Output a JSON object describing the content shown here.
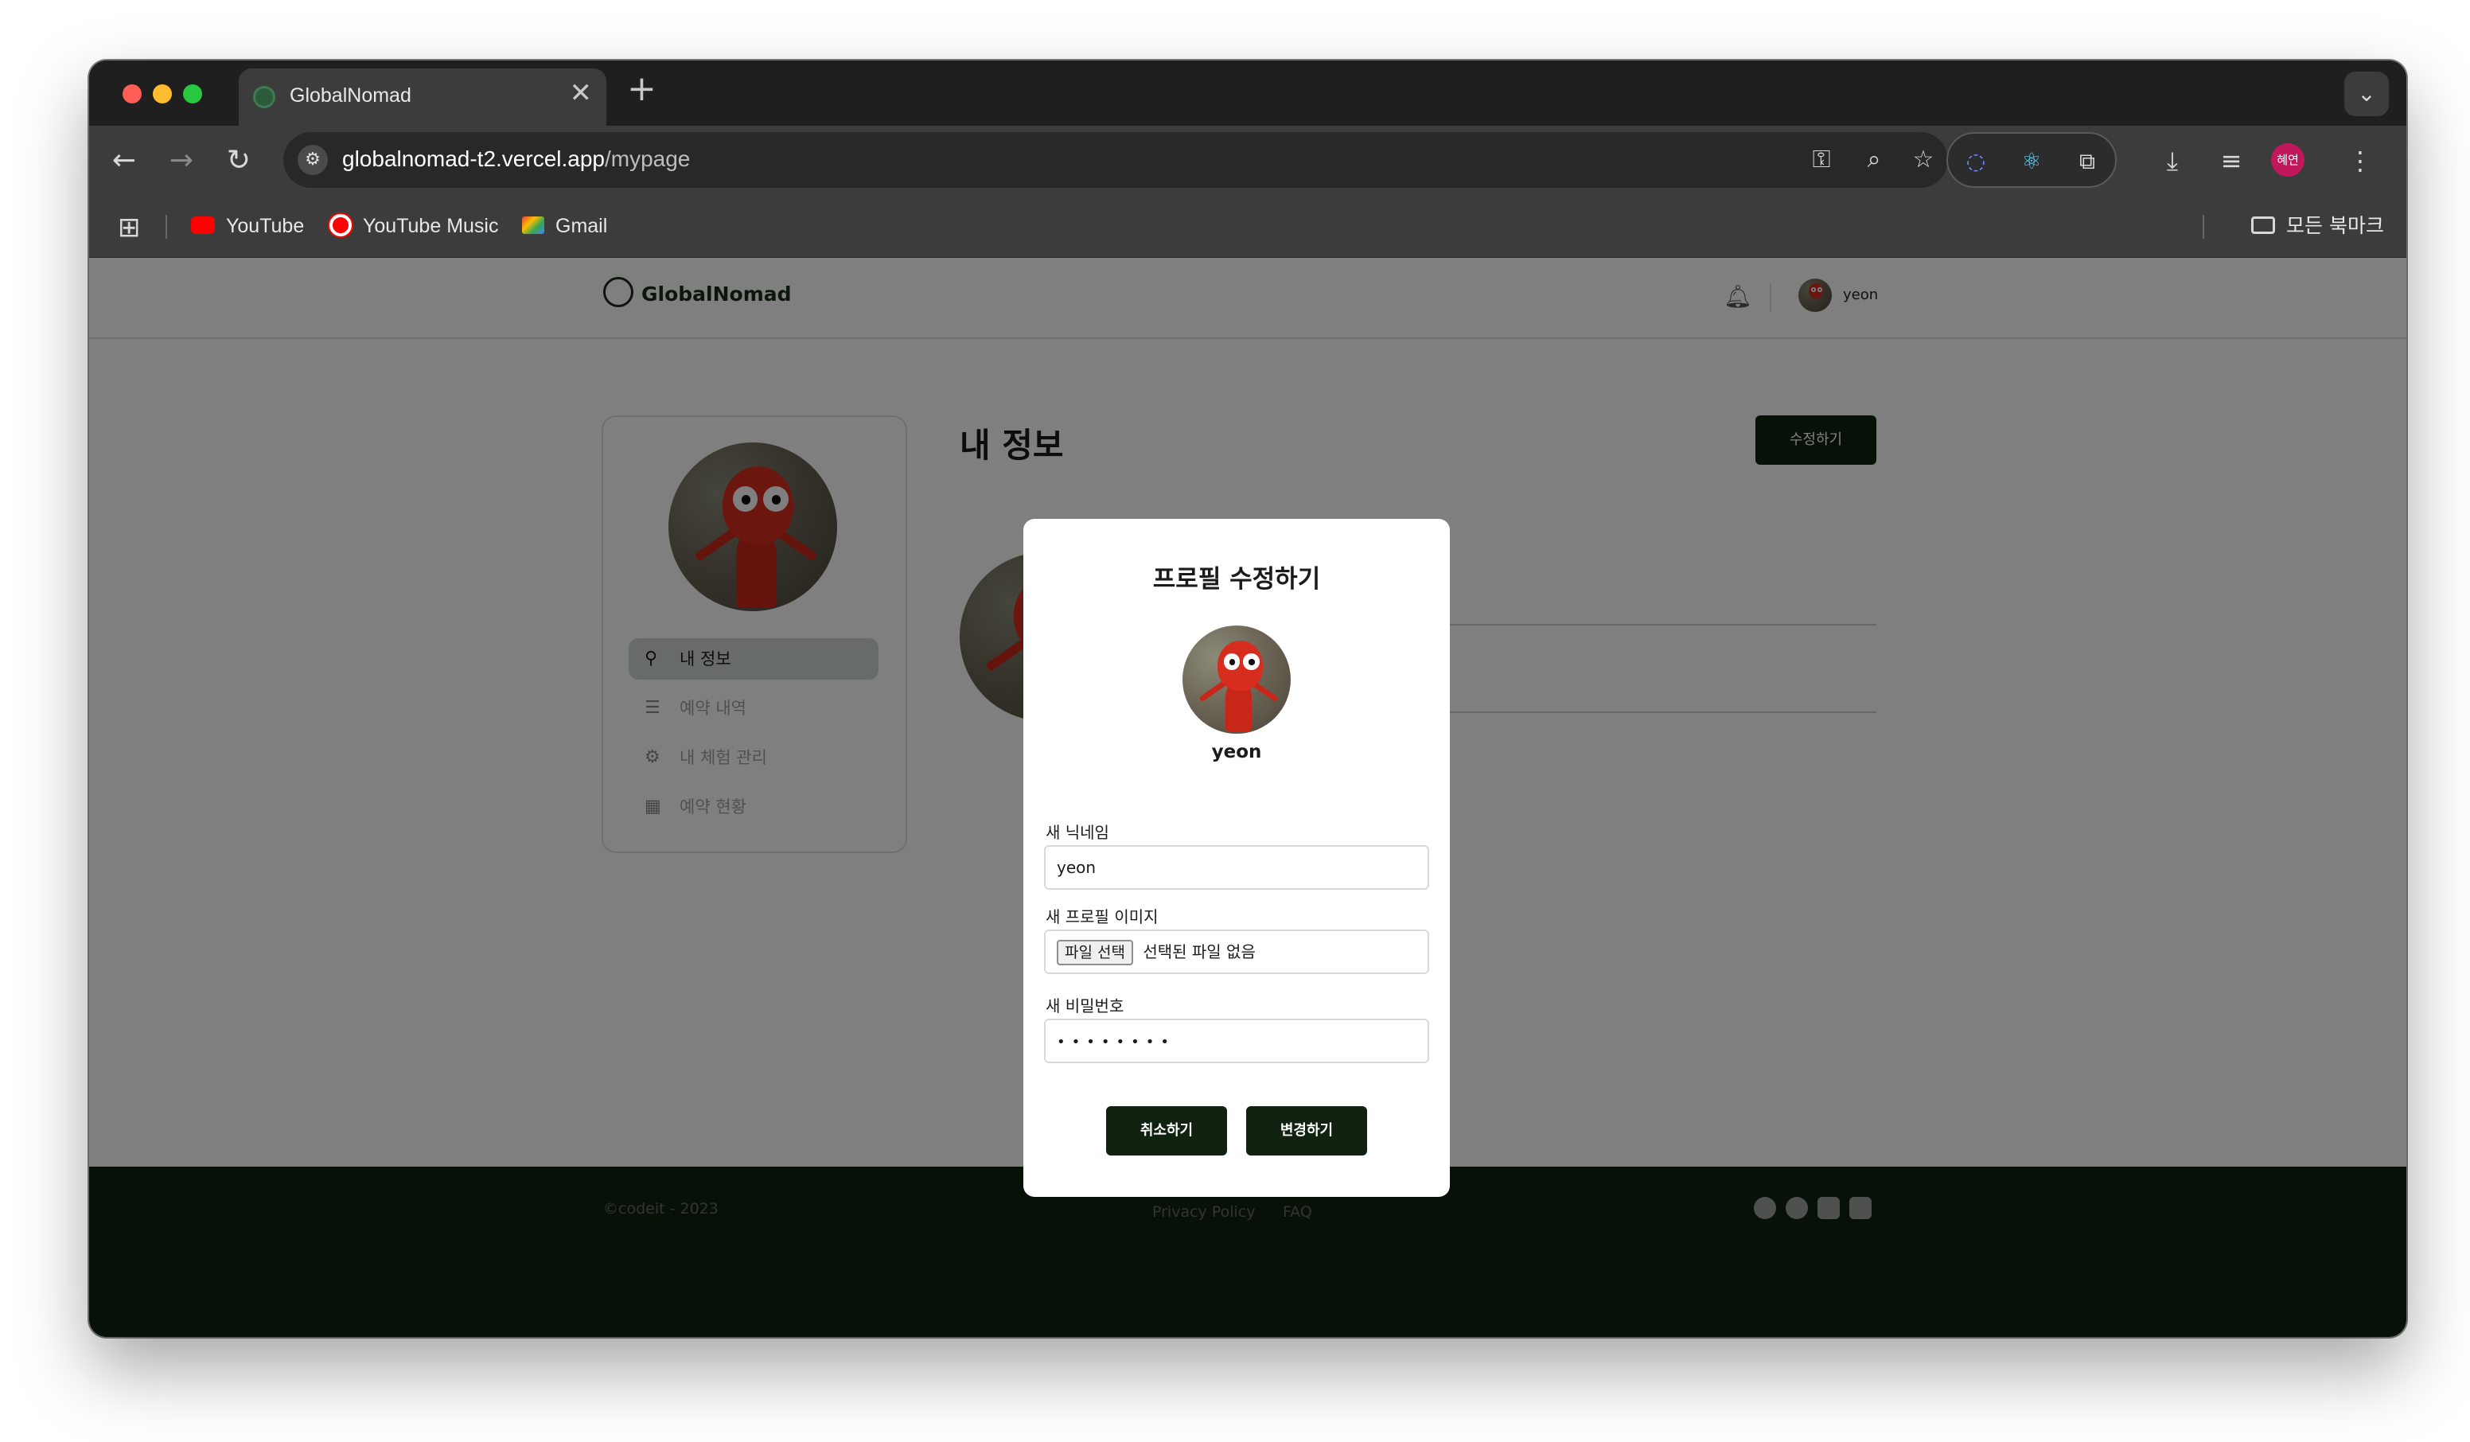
{
  "browser": {
    "tab_title": "GlobalNomad",
    "tab_close": "✕",
    "new_tab": "+",
    "tab_menu": "⌄",
    "url_host": "globalnomad-t2.vercel.app",
    "url_path": "/mypage",
    "profile_label": "혜연",
    "bookmarks": [
      "YouTube",
      "YouTube Music",
      "Gmail"
    ],
    "bookmarks_folder": "모든 북마크",
    "icons": [
      "back-icon",
      "forward-icon",
      "reload-icon",
      "site-settings-icon",
      "password-key-icon",
      "zoom-icon",
      "bookmark-star-icon",
      "extension-icon",
      "react-devtools-icon",
      "extensions-puzzle-icon",
      "download-icon",
      "media-control-icon",
      "more-menu-icon",
      "apps-grid-icon",
      "folder-icon"
    ]
  },
  "site": {
    "logo": "GlobalNomad",
    "header_user": "yeon"
  },
  "sidebar": {
    "items": [
      {
        "label": "내 정보",
        "icon": "user-icon",
        "active": true
      },
      {
        "label": "예약 내역",
        "icon": "list-icon",
        "active": false
      },
      {
        "label": "내 체험 관리",
        "icon": "gear-icon",
        "active": false
      },
      {
        "label": "예약 현황",
        "icon": "calendar-icon",
        "active": false
      }
    ]
  },
  "main": {
    "title": "내 정보",
    "edit_button": "수정하기"
  },
  "modal": {
    "title": "프로필 수정하기",
    "nickname": "yeon",
    "nickname_label": "새 닉네임",
    "nickname_value": "yeon",
    "image_label": "새 프로필 이미지",
    "file_button": "파일 선택",
    "file_status": "선택된 파일 없음",
    "password_label": "새 비밀번호",
    "password_value": "••••••••",
    "cancel_button": "취소하기",
    "submit_button": "변경하기"
  },
  "footer": {
    "copyright": "©codeit - 2023",
    "links": [
      "Privacy Policy",
      "FAQ"
    ],
    "social": [
      "facebook-icon",
      "twitter-icon",
      "youtube-icon",
      "instagram-icon"
    ]
  },
  "colors": {
    "brand_dark": "#112211",
    "active_nav_bg": "#ced8d5",
    "overlay": "rgba(0,0,0,0.5)"
  }
}
